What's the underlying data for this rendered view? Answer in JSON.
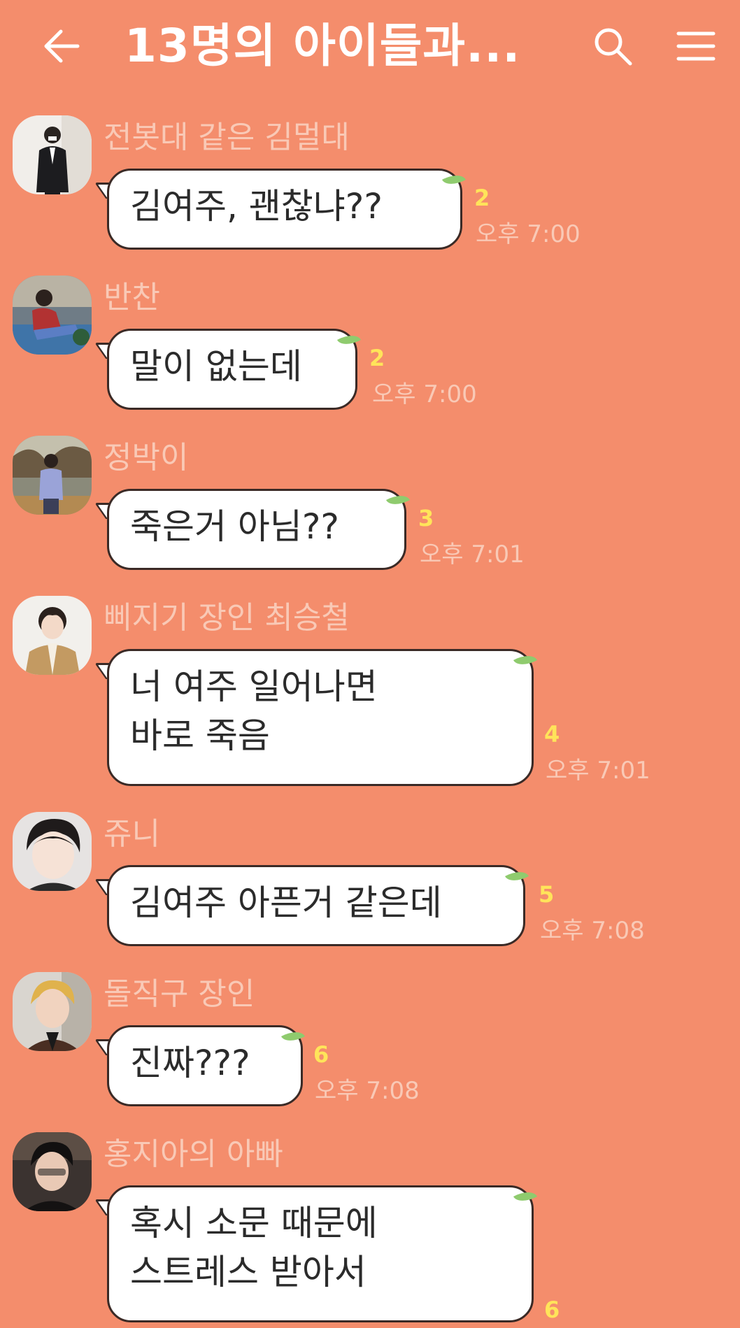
{
  "header": {
    "title": "13명의 아이들과...",
    "back_icon": "arrow-left-icon",
    "search_icon": "search-icon",
    "menu_icon": "hamburger-menu-icon"
  },
  "colors": {
    "background": "#F48D6C",
    "bubble": "#FFFFFF",
    "sender_name": "#F9C9B6",
    "unread_count": "#FFE45A",
    "leaf": "#8FCB6E"
  },
  "messages": [
    {
      "sender": "전봇대 같은 김멀대",
      "text": "김여주, 괜찮냐??",
      "unread": "2",
      "time": "오후 7:00"
    },
    {
      "sender": "반찬",
      "text": "말이 없는데",
      "unread": "2",
      "time": "오후 7:00"
    },
    {
      "sender": "정박이",
      "text": "죽은거 아님??",
      "unread": "3",
      "time": "오후 7:01"
    },
    {
      "sender": "삐지기 장인 최승철",
      "text": "너 여주 일어나면\n바로 죽음",
      "unread": "4",
      "time": "오후 7:01"
    },
    {
      "sender": "쥬니",
      "text": "김여주 아픈거 같은데",
      "unread": "5",
      "time": "오후 7:08"
    },
    {
      "sender": "돌직구 장인",
      "text": "진짜???",
      "unread": "6",
      "time": "오후 7:08"
    },
    {
      "sender": "홍지아의 아빠",
      "text": "혹시 소문 때문에\n스트레스 받아서",
      "unread": "6",
      "time": ""
    }
  ]
}
